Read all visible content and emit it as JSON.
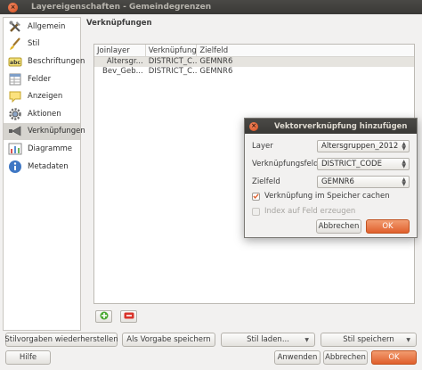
{
  "window": {
    "title": "Layereigenschaften - Gemeindegrenzen",
    "close_glyph": "×"
  },
  "sidebar": {
    "items": [
      {
        "label": "Allgemein",
        "icon": "tools-icon"
      },
      {
        "label": "Stil",
        "icon": "brush-icon"
      },
      {
        "label": "Beschriftungen",
        "icon": "label-abc-icon"
      },
      {
        "label": "Felder",
        "icon": "fields-icon"
      },
      {
        "label": "Anzeigen",
        "icon": "tooltip-icon"
      },
      {
        "label": "Aktionen",
        "icon": "gear-icon"
      },
      {
        "label": "Verknüpfungen",
        "icon": "join-icon"
      },
      {
        "label": "Diagramme",
        "icon": "chart-icon"
      },
      {
        "label": "Metadaten",
        "icon": "info-icon"
      }
    ],
    "selected_index": 6
  },
  "main": {
    "heading": "Verknüpfungen",
    "table": {
      "columns": [
        "Joinlayer",
        "Verknüpfungs",
        "Zielfeld"
      ],
      "rows": [
        [
          "Altersgr...",
          "DISTRICT_C...",
          "GEMNR6"
        ],
        [
          "Bev_Geb...",
          "DISTRICT_C...",
          "GEMNR6"
        ]
      ]
    }
  },
  "buttons": {
    "restore_defaults": "Stilvorgaben wiederherstellen",
    "save_as_default": "Als Vorgabe speichern",
    "load_style": "Stil laden...",
    "save_style": "Stil speichern",
    "help": "Hilfe",
    "apply": "Anwenden",
    "cancel": "Abbrechen",
    "ok": "OK"
  },
  "dialog": {
    "title": "Vektorverknüpfung hinzufügen",
    "layer_label": "Layer",
    "layer_value": "Altersgruppen_2012",
    "join_field_label": "Verknüpfungsfeld",
    "join_field_value": "DISTRICT_CODE",
    "target_field_label": "Zielfeld",
    "target_field_value": "GEMNR6",
    "cache_label": "Verknüpfung im Speicher cachen",
    "cache_checked": true,
    "index_label": "Index auf Feld erzeugen",
    "index_checked": false,
    "index_enabled": false,
    "cancel": "Abbrechen",
    "ok": "OK"
  },
  "colors": {
    "accent": "#e0602d",
    "selected_row": "#e6e4df",
    "titlebar": "#3c3b37"
  }
}
